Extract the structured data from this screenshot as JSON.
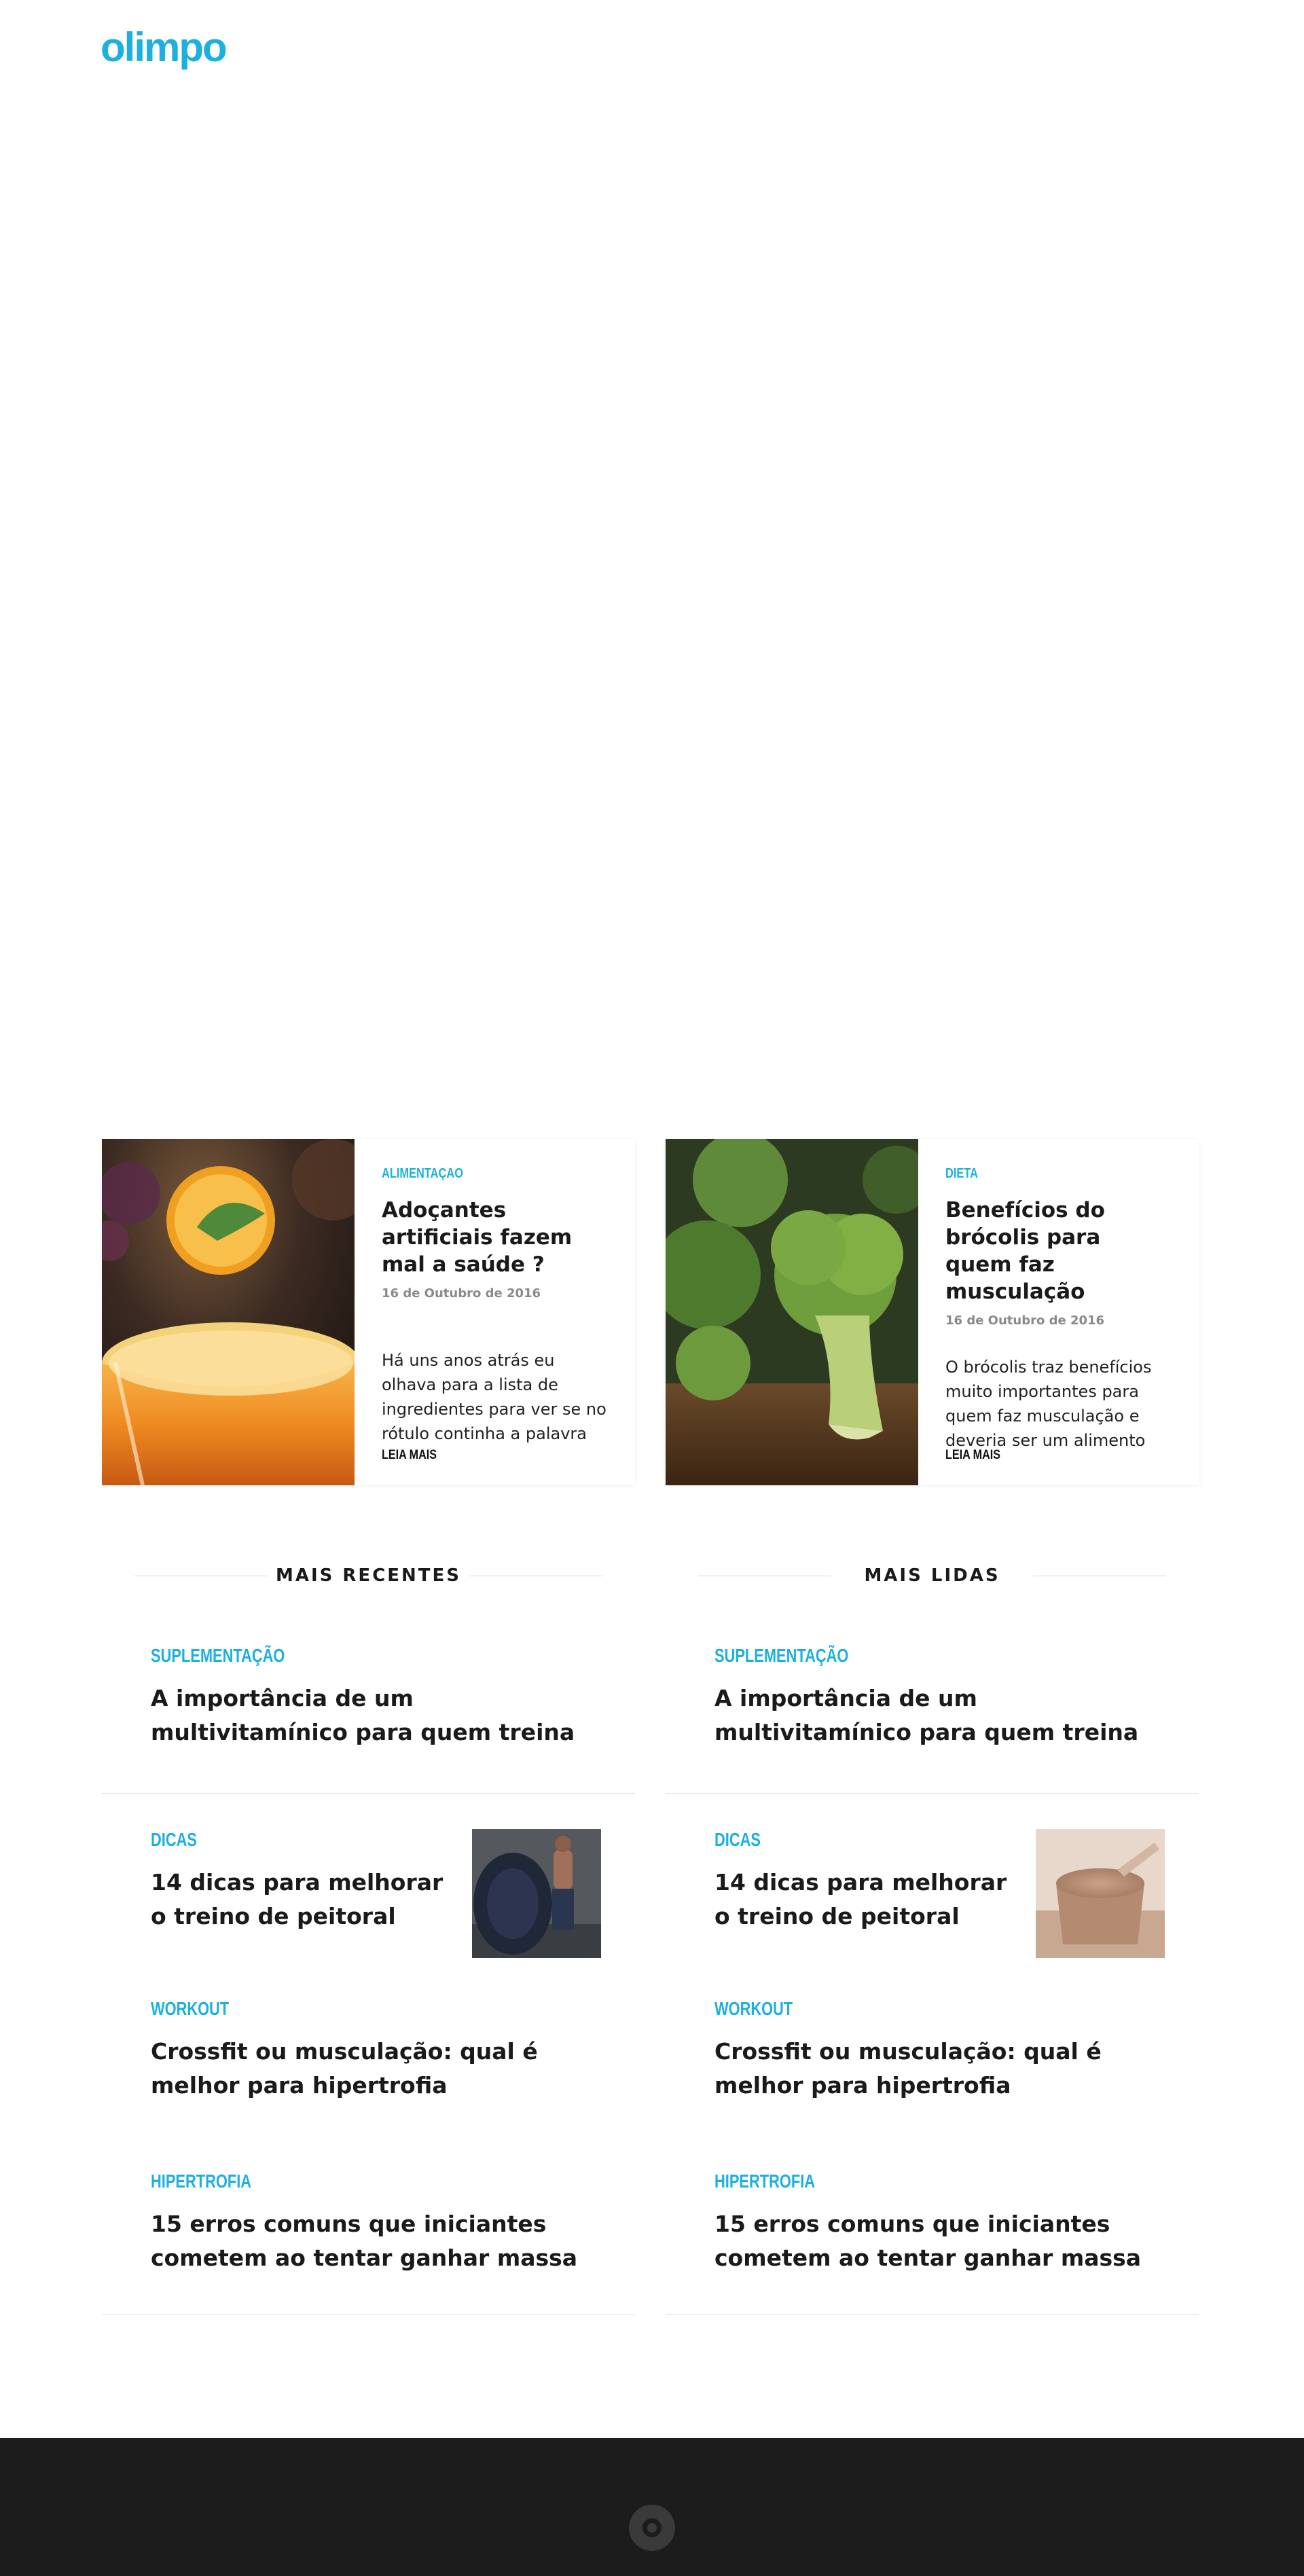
{
  "header": {
    "logo_text": "olimpo"
  },
  "featured": [
    {
      "category": "ALIMENTAÇAO",
      "title": "Adoçantes artificiais fazem mal a saúde ?",
      "date": "16 de Outubro de 2016",
      "excerpt": "Há uns anos atrás eu olhava para a lista de ingredientes para ver se no rótulo continha a palavra",
      "cta": "LEIA MAIS",
      "image": "orange-juice-photo"
    },
    {
      "category": "DIETA",
      "title": "Benefícios do brócolis para quem faz musculação",
      "date": "16 de Outubro de 2016",
      "excerpt": "O brócolis traz benefícios muito importantes para quem faz musculação e deveria ser um alimento",
      "cta": "LEIA MAIS",
      "image": "broccoli-photo"
    }
  ],
  "recent": {
    "heading": "MAIS RECENTES",
    "posts": [
      {
        "category": "SUPLEMENTAÇÃO",
        "title": "A importância de um multivitamínico para quem treina"
      },
      {
        "category": "DICAS",
        "title": "14 dicas para melhorar o treino de peitoral",
        "thumb": "tire-flip-athlete-photo"
      },
      {
        "category": "WORKOUT",
        "title": "Crossfit ou musculação: qual é melhor para hipertrofia"
      },
      {
        "category": "HIPERTROFIA",
        "title": "15 erros comuns que iniciantes cometem ao tentar ganhar massa"
      }
    ]
  },
  "popular": {
    "heading": "MAIS LIDAS",
    "posts": [
      {
        "category": "SUPLEMENTAÇÃO",
        "title": "A importância de um multivitamínico para quem treina"
      },
      {
        "category": "DICAS",
        "title": "14 dicas para melhorar o treino de peitoral",
        "thumb": "protein-powder-photo"
      },
      {
        "category": "WORKOUT",
        "title": "Crossfit ou musculação: qual é melhor para hipertrofia"
      },
      {
        "category": "HIPERTROFIA",
        "title": "15 erros comuns que iniciantes cometem ao tentar ganhar massa"
      }
    ]
  },
  "footer": {
    "icon": "olimpo-o-icon"
  },
  "colors": {
    "accent": "#1bb0e0",
    "footer_bg": "#1c1c1c",
    "text": "#1a1a1a"
  }
}
